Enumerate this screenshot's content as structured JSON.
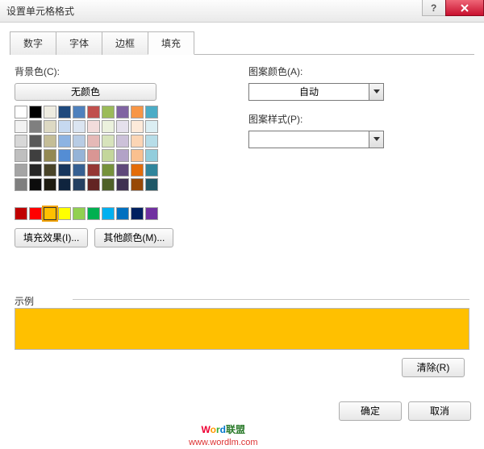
{
  "window": {
    "title": "设置单元格格式"
  },
  "tabs": {
    "t0": "数字",
    "t1": "字体",
    "t2": "边框",
    "t3": "填充",
    "active_index": 3
  },
  "fill": {
    "bg_label": "背景色(C):",
    "no_color": "无颜色",
    "fill_effects": "填充效果(I)...",
    "more_colors": "其他颜色(M)...",
    "pattern_color_label": "图案颜色(A):",
    "pattern_color_value": "自动",
    "pattern_style_label": "图案样式(P):",
    "pattern_style_value": ""
  },
  "palette": {
    "row1": [
      "#ffffff",
      "#000000",
      "#eeece1",
      "#1f497d",
      "#4f81bd",
      "#c0504d",
      "#9bbb59",
      "#8064a2",
      "#f79646",
      "#4bacc6"
    ],
    "row2": [
      "#f2f2f2",
      "#7f7f7f",
      "#ddd9c3",
      "#c6d9f0",
      "#dbe5f1",
      "#f2dcdb",
      "#ebf1dd",
      "#e5e0ec",
      "#fdeada",
      "#dbeef3"
    ],
    "row3": [
      "#d8d8d8",
      "#595959",
      "#c4bd97",
      "#8db3e2",
      "#b8cce4",
      "#e5b9b7",
      "#d7e3bc",
      "#ccc1d9",
      "#fbd5b5",
      "#b7dde8"
    ],
    "row4": [
      "#bfbfbf",
      "#3f3f3f",
      "#938953",
      "#548dd4",
      "#95b3d7",
      "#d99694",
      "#c3d69b",
      "#b2a2c7",
      "#fac08f",
      "#92cddc"
    ],
    "row5": [
      "#a5a5a5",
      "#262626",
      "#494429",
      "#17365d",
      "#366092",
      "#953734",
      "#76923c",
      "#5f497a",
      "#e36c09",
      "#31859b"
    ],
    "row6": [
      "#7f7f7f",
      "#0c0c0c",
      "#1d1b10",
      "#0f243e",
      "#244061",
      "#632423",
      "#4f6128",
      "#3f3151",
      "#974806",
      "#205867"
    ],
    "std": [
      "#c00000",
      "#ff0000",
      "#ffc000",
      "#ffff00",
      "#92d050",
      "#00b050",
      "#00b0f0",
      "#0070c0",
      "#002060",
      "#7030a0"
    ],
    "selected": "#ffc000"
  },
  "sample": {
    "label": "示例",
    "color": "#ffc000"
  },
  "buttons": {
    "clear": "清除(R)",
    "ok": "确定",
    "cancel": "取消"
  },
  "watermark": {
    "line1_w": "W",
    "line1_o": "o",
    "line1_r": "r",
    "line1_d": "d",
    "line1_cn": "联盟",
    "line2": "www.wordlm.com"
  }
}
